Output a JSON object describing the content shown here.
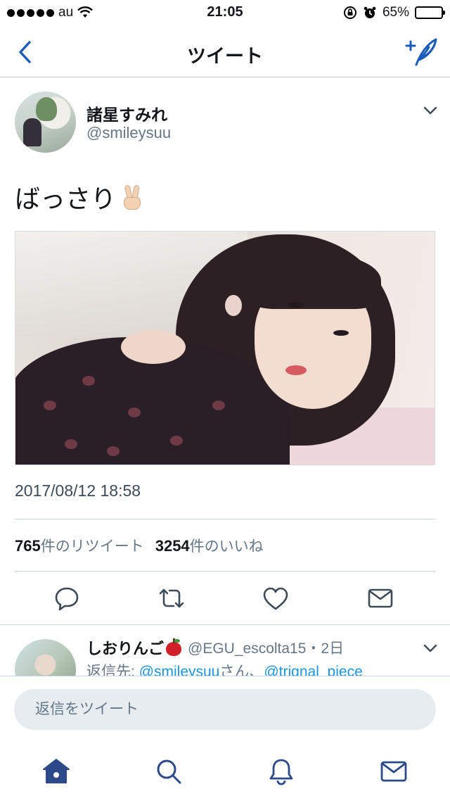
{
  "status_bar": {
    "carrier": "au",
    "time": "21:05",
    "battery_percent": "65%",
    "battery_level": 0.65
  },
  "nav": {
    "title": "ツイート",
    "back_icon": "chevron-left-icon",
    "compose_icon": "compose-tweet-icon"
  },
  "tweet": {
    "user_name": "諸星すみれ",
    "user_handle": "@smileysuu",
    "text": "ばっさり",
    "emoji": "victory-hand",
    "timestamp": "2017/08/12 18:58",
    "retweet_count": "765",
    "retweet_label": "件のリツイート",
    "like_count": "3254",
    "like_label": "件のいいね",
    "actions": [
      "reply-icon",
      "retweet-icon",
      "like-icon",
      "direct-message-icon"
    ]
  },
  "reply": {
    "user_name": "しおりんご",
    "handle_time": "@EGU_escolta15・2日",
    "reply_to_prefix": "返信先: ",
    "reply_to_mention_1": "@smileysuu",
    "reply_to_sep": "さん、",
    "reply_to_mention_2": "@trignal_piece"
  },
  "composer": {
    "placeholder": "返信をツイート"
  },
  "tabbar": {
    "items": [
      "home-icon",
      "search-icon",
      "notifications-icon",
      "messages-icon"
    ],
    "active": "home-icon"
  },
  "colors": {
    "accent": "#1b95e0",
    "icon_dark_blue": "#2c4a8a",
    "secondary_text": "#657786"
  }
}
